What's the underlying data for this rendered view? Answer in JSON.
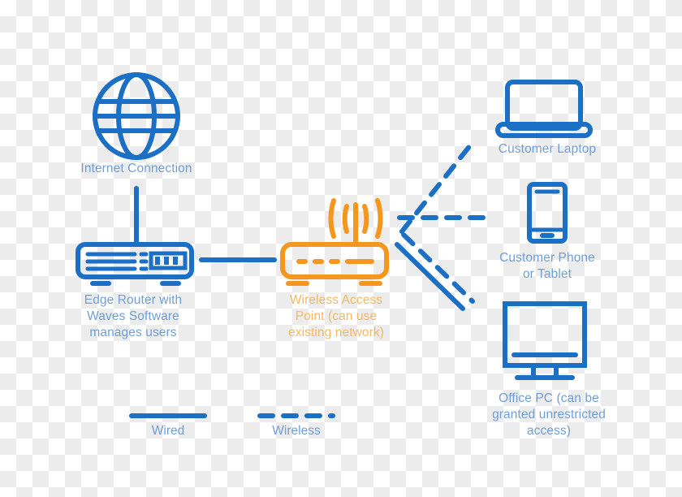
{
  "diagram": {
    "title": "Network topology: Edge Router with Waves Software, Wireless Access Point and client devices",
    "colors": {
      "blue": "#1b6fc4",
      "blue_label": "#6f9fd8",
      "orange": "#f5961e",
      "orange_label": "#f5b866",
      "background_light": "#ffffff",
      "background_checker": "#ececec"
    },
    "nodes": [
      {
        "id": "internet",
        "icon": "globe-icon",
        "label": "Internet Connection",
        "color": "#1b6fc4"
      },
      {
        "id": "edge-router",
        "icon": "router-icon",
        "label": "Edge Router with\nWaves Software\nmanages users",
        "color": "#1b6fc4"
      },
      {
        "id": "wireless-access-point",
        "icon": "wireless-access-point-icon",
        "label": "Wireless Access\nPoint (can use\nexisting network)",
        "color": "#f5961e"
      },
      {
        "id": "customer-laptop",
        "icon": "laptop-icon",
        "label": "Customer Laptop",
        "color": "#1b6fc4"
      },
      {
        "id": "customer-phone",
        "icon": "smartphone-icon",
        "label": "Customer Phone\nor Tablet",
        "color": "#1b6fc4"
      },
      {
        "id": "office-pc",
        "icon": "desktop-monitor-icon",
        "label": "Office PC (can be\ngranted unrestricted\naccess)",
        "color": "#1b6fc4"
      }
    ],
    "connections": [
      {
        "id": "internet-to-edge-router",
        "from": "internet",
        "to": "edge-router",
        "type": "wired"
      },
      {
        "id": "edge-router-to-wap",
        "from": "edge-router",
        "to": "wireless-access-point",
        "type": "wired"
      },
      {
        "id": "wap-to-laptop",
        "from": "wireless-access-point",
        "to": "customer-laptop",
        "type": "wireless"
      },
      {
        "id": "wap-to-phone",
        "from": "wireless-access-point",
        "to": "customer-phone",
        "type": "wireless"
      },
      {
        "id": "wap-to-office-pc-wireless",
        "from": "wireless-access-point",
        "to": "office-pc",
        "type": "wireless"
      },
      {
        "id": "wap-to-office-pc-wired",
        "from": "wireless-access-point",
        "to": "office-pc",
        "type": "wired"
      }
    ]
  },
  "legend": {
    "items": [
      {
        "id": "wired",
        "label": "Wired",
        "style": "solid",
        "color": "#1b6fc4"
      },
      {
        "id": "wireless",
        "label": "Wireless",
        "style": "dashed",
        "color": "#1b6fc4"
      }
    ]
  }
}
